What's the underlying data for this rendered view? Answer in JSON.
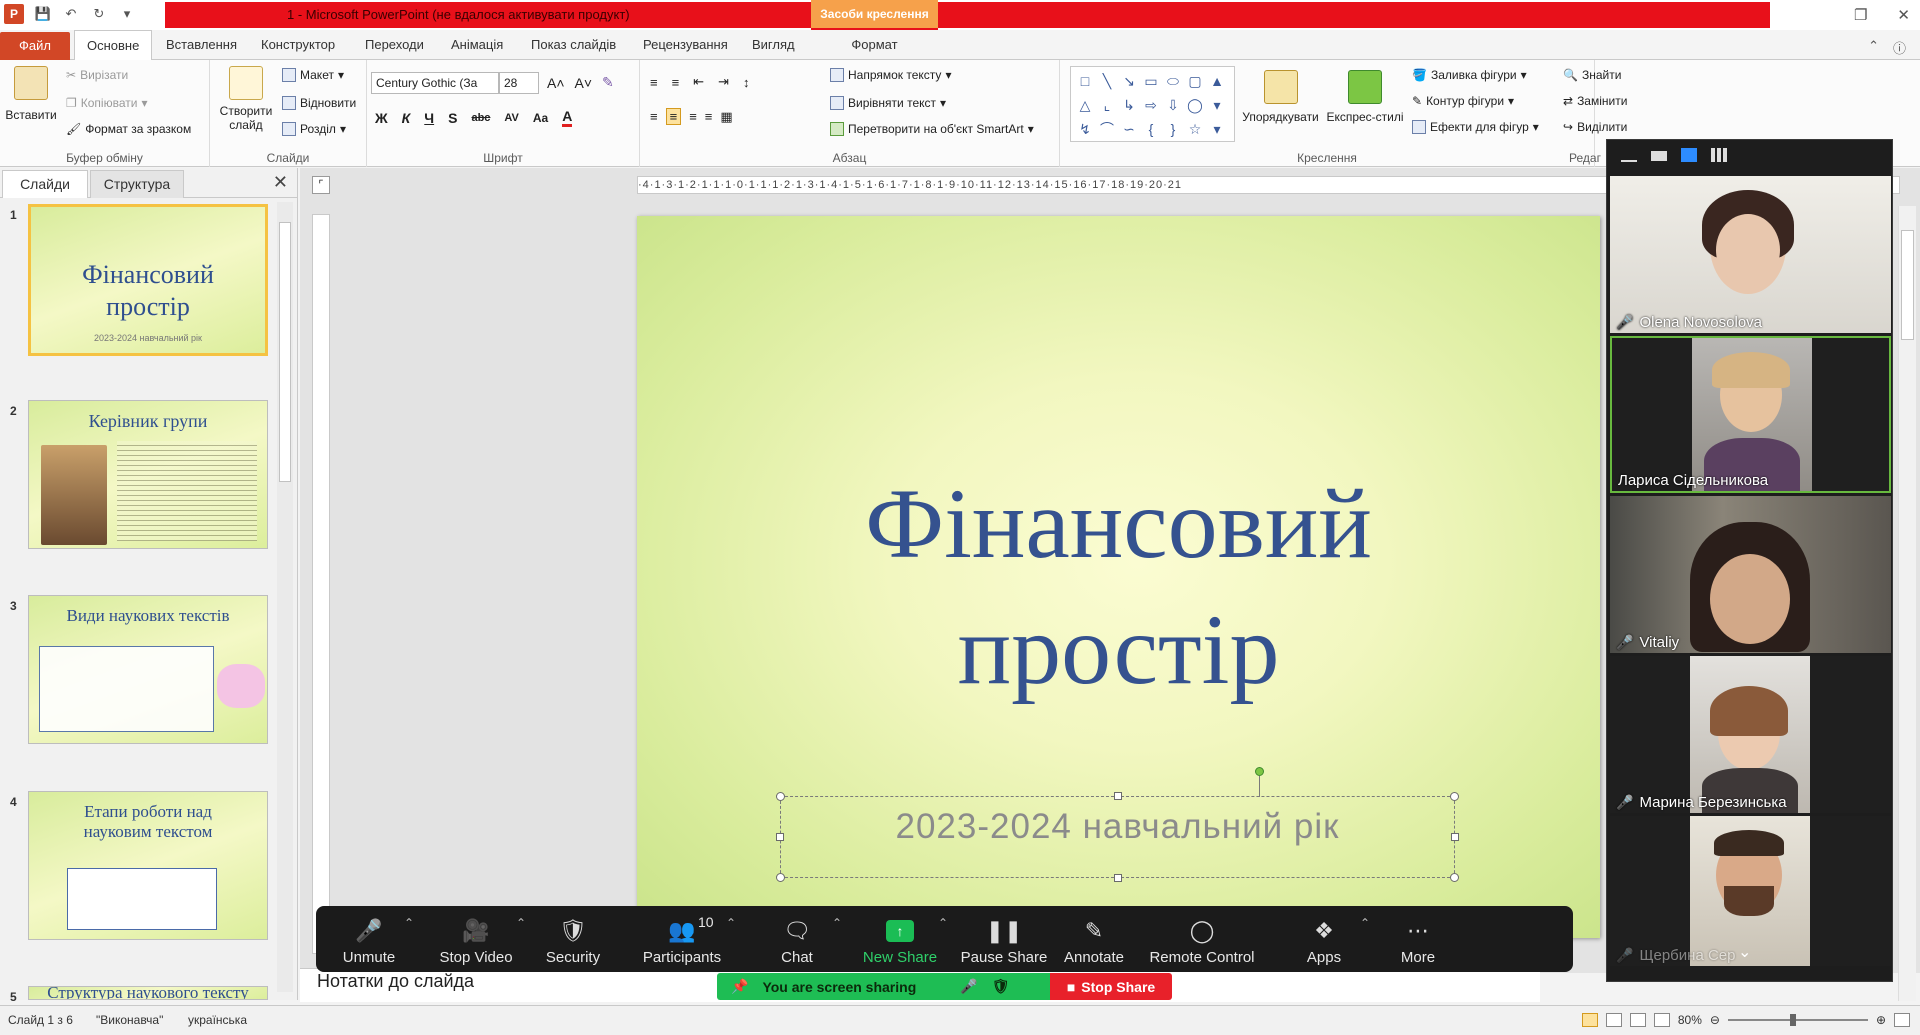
{
  "window": {
    "title": "1 - Microsoft PowerPoint (не вдалося активувати продукт)",
    "context_tab": "Засоби креслення"
  },
  "tabs": {
    "file": "Файл",
    "items": [
      "Основне",
      "Вставлення",
      "Конструктор",
      "Переходи",
      "Анімація",
      "Показ слайдів",
      "Рецензування",
      "Вигляд"
    ],
    "format": "Формат",
    "active": "Основне"
  },
  "ribbon": {
    "clipboard": {
      "paste": "Вставити",
      "cut": "Вирізати",
      "copy": "Копіювати",
      "format_painter": "Формат за зразком",
      "label": "Буфер обміну"
    },
    "slides": {
      "new_slide_line1": "Створити",
      "new_slide_line2": "слайд",
      "layout": "Макет",
      "reset": "Відновити",
      "section": "Розділ",
      "label": "Слайди"
    },
    "font": {
      "name": "Century Gothic (За",
      "size": "28",
      "label": "Шрифт"
    },
    "paragraph": {
      "text_direction": "Напрямок тексту",
      "align_text": "Вирівняти текст",
      "smartart": "Перетворити на об'єкт SmartArt",
      "label": "Абзац"
    },
    "drawing": {
      "arrange": "Упорядкувати",
      "quick_styles": "Експрес-стилі",
      "fill": "Заливка фігури",
      "outline": "Контур фігури",
      "effects": "Ефекти для фігур",
      "label": "Креслення"
    },
    "editing": {
      "find": "Знайти",
      "replace": "Замінити",
      "select": "Виділити",
      "label": "Редаг"
    }
  },
  "panel": {
    "tab_slides": "Слайди",
    "tab_outline": "Структура",
    "thumbs": [
      {
        "num": "1",
        "title": "Фінансовий простір",
        "sub": "2023-2024 навчальний рік"
      },
      {
        "num": "2",
        "title": "Керівник групи"
      },
      {
        "num": "3",
        "title": "Види наукових текстів"
      },
      {
        "num": "4",
        "title": "Етапи роботи  над науковим текстом"
      },
      {
        "num": "5",
        "title": "Структура наукового  тексту"
      }
    ]
  },
  "slide": {
    "title_line1": "Фінансовий",
    "title_line2": "простір",
    "subtitle": "2023-2024 навчальний  рік"
  },
  "notes": {
    "placeholder": "Нотатки до слайда"
  },
  "status": {
    "slide": "Слайд 1 з 6",
    "theme": "\"Виконавча\"",
    "language": "українська",
    "zoom": "80%"
  },
  "zoom_toolbar": {
    "unmute": "Unmute",
    "stop_video": "Stop Video",
    "security": "Security",
    "participants": "Participants",
    "participants_count": "10",
    "chat": "Chat",
    "new_share": "New Share",
    "pause_share": "Pause Share",
    "annotate": "Annotate",
    "remote_control": "Remote Control",
    "apps": "Apps",
    "more": "More"
  },
  "sharing_banner": {
    "text": "You are screen sharing",
    "stop": "Stop Share"
  },
  "participants": [
    {
      "name": "Olena Novosolova"
    },
    {
      "name": "Лариса Сідельникова",
      "active": true
    },
    {
      "name": "Vitaliy"
    },
    {
      "name": "Марина Березинська"
    },
    {
      "name": "Щербина Сер"
    }
  ],
  "colors": {
    "accent_file": "#d24726",
    "title_bar_red": "#e8101a",
    "slide_title": "#35528f",
    "zoom_green": "#1ebd54",
    "zoom_red": "#e8212a"
  }
}
